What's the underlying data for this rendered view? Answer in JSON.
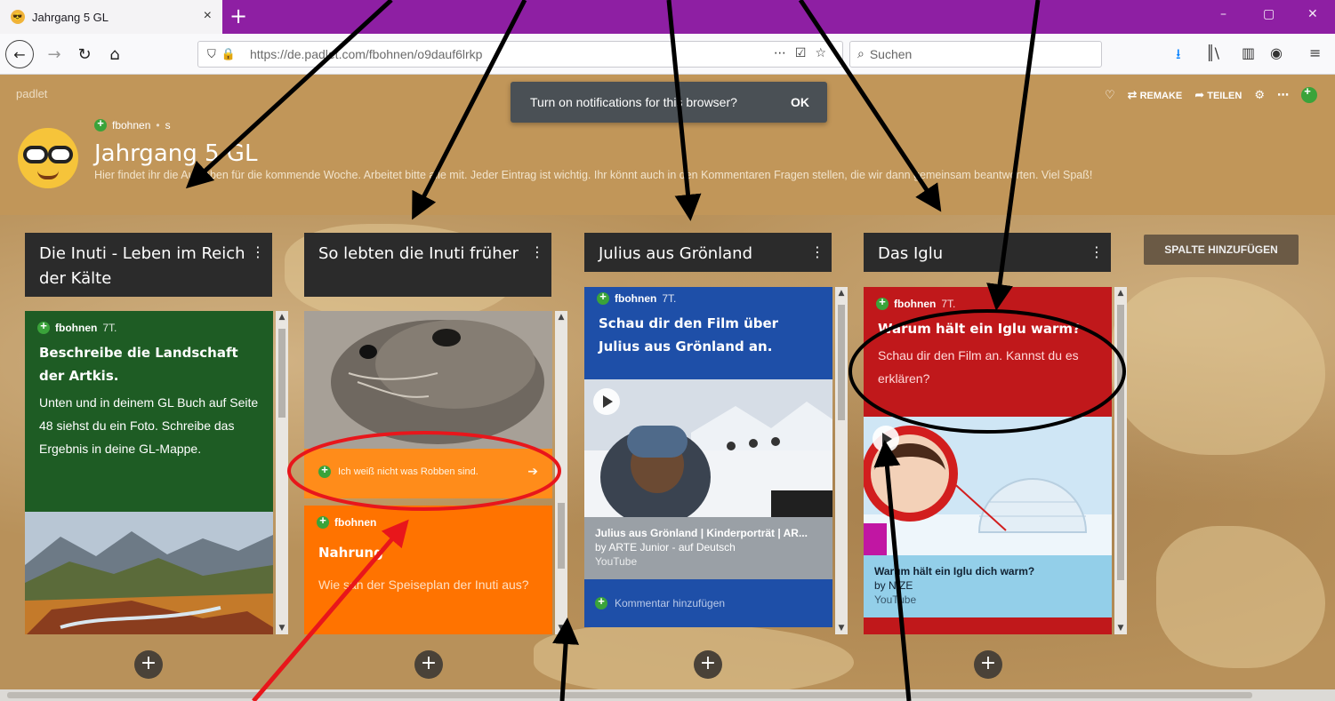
{
  "browser": {
    "tab_title": "Jahrgang 5 GL",
    "tab_close": "×",
    "new_tab": "+",
    "url": "https://de.padlet.com/fbohnen/o9dauf6lrkp",
    "search_placeholder": "Suchen",
    "window_buttons": [
      "–",
      "▢",
      "✕"
    ]
  },
  "padlet": {
    "logo": "padlet",
    "toast_text": "Turn on notifications for this browser?",
    "toast_ok": "OK",
    "actions": {
      "remake": "REMAKE",
      "share": "TEILEN"
    },
    "author": "fbohnen",
    "author_suffix": "s",
    "title": "Jahrgang 5 GL",
    "description": "Hier findet ihr die Aufgaben für die kommende Woche. Arbeitet bitte alle mit. Jeder Eintrag ist wichtig. Ihr könnt auch in den Kommentaren Fragen stellen, die wir dann gemeinsam beantworten. Viel Spaß!",
    "add_column": "SPALTE HINZUFÜGEN"
  },
  "columns": [
    {
      "title": "Die Inuti - Leben im Reich der Kälte",
      "post": {
        "author": "fbohnen",
        "time": "7T.",
        "heading": "Beschreibe die Landschaft der Artkis.",
        "body": "Unten und in deinem GL Buch auf Seite 48 siehst du ein Foto. Schreibe das Ergebnis in deine GL-Mappe.",
        "color": "#1e5c24"
      }
    },
    {
      "title": "So lebten die Inuti früher",
      "comment": "Ich weiß nicht was Robben sind.",
      "post": {
        "author": "fbohnen",
        "heading": "Nahrung",
        "body": "Wie sah der Speiseplan der Inuti aus?",
        "color": "#ff7300"
      }
    },
    {
      "title": "Julius aus Grönland",
      "post": {
        "author": "fbohnen",
        "time": "7T.",
        "heading": "Schau dir den Film über Julius aus Grönland an.",
        "video_title": "Julius aus Grönland | Kinderporträt | AR...",
        "video_by": "by ARTE Junior - auf Deutsch",
        "video_src": "YouTube",
        "comment_placeholder": "Kommentar hinzufügen",
        "color": "#1e4fa8"
      }
    },
    {
      "title": "Das Iglu",
      "post": {
        "author": "fbohnen",
        "time": "7T.",
        "heading": "Warum hält ein Iglu warm?",
        "body": "Schau dir den Film an. Kannst du es erklären?",
        "video_title": "Warum hält ein Iglu dich warm?",
        "video_by": "by NIZE",
        "video_src": "YouTube",
        "color": "#c0181b"
      }
    }
  ],
  "colors": {
    "title_bar": "#8e1fa3",
    "column_header": "#2b2b2b",
    "annotation_black": "#000000",
    "annotation_red": "#e8161b"
  }
}
